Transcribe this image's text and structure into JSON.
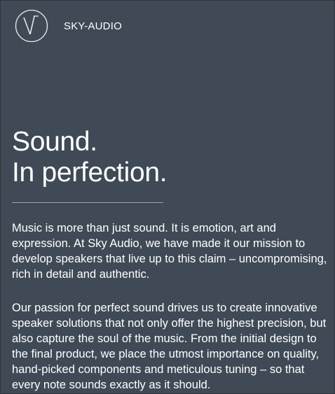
{
  "brand": {
    "name": "SKY-AUDIO",
    "logo_icon": "sky-audio-v-circle-icon"
  },
  "hero": {
    "line1": "Sound.",
    "line2": "In perfection."
  },
  "body": {
    "paragraph1": "Music is more than just sound. It is emotion, art and expression. At Sky Audio, we have made it our mission to develop speakers that live up to this claim – uncompromising, rich in detail and authentic.",
    "paragraph2": "Our passion for perfect sound drives us to create innovative speaker solutions that not only offer the highest precision, but also capture the soul of the music. From the initial design to the final product, we place the utmost importance on quality, hand-picked components and meticulous tuning – so that every note sounds exactly as it should."
  },
  "colors": {
    "background": "#3f4a56",
    "text": "#ffffff",
    "divider": "#9aa3ad"
  }
}
